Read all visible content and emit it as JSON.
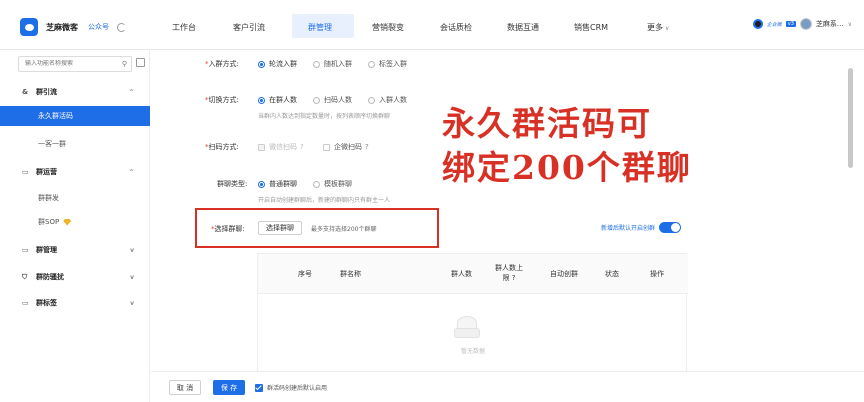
{
  "header": {
    "brand": "芝麻微客",
    "brand_sub": "公众号",
    "nav": [
      "工作台",
      "客户引流",
      "群管理",
      "营销裂变",
      "会话质检",
      "数据互通",
      "销售CRM",
      "更多"
    ],
    "user_badge": "企业微",
    "user_v": "v3",
    "user_name": "芝麻系..."
  },
  "sidebar": {
    "search_placeholder": "输入功能名称搜索",
    "groups": [
      {
        "icon": "group-icon",
        "label": "群引流",
        "items": [
          "永久群活码",
          "一客一群"
        ]
      },
      {
        "icon": "chat-icon",
        "label": "群运营",
        "items": [
          "群群发",
          "群SOP"
        ]
      },
      {
        "icon": "chat-icon",
        "label": "群管理",
        "items": []
      },
      {
        "icon": "shield-icon",
        "label": "群防骚扰",
        "items": []
      },
      {
        "icon": "chat-icon",
        "label": "群标签",
        "items": []
      }
    ]
  },
  "form": {
    "join_mode": {
      "label": "入群方式:",
      "options": [
        "轮流入群",
        "随机入群",
        "标签入群"
      ],
      "selected": 0
    },
    "switch_mode": {
      "label": "切换方式:",
      "options": [
        "在群人数",
        "扫码人数",
        "入群人数"
      ],
      "selected": 0,
      "hint": "当群内人数达到指定数量时，按列表顺序切换群聊"
    },
    "scan_mode": {
      "label": "扫码方式:",
      "options": [
        "微信扫码",
        "企微扫码"
      ]
    },
    "chat_type": {
      "label": "群聊类型:",
      "options": [
        "普通群聊",
        "模板群聊"
      ],
      "selected": 0,
      "hint": "开启自动创建群聊后，新建的群聊内只有群主一人"
    },
    "select_chat": {
      "label": "选择群聊:",
      "button": "选择群聊",
      "hint": "最多支持选择200个群聊"
    },
    "auto_create": "新增后默认开启创群"
  },
  "overlay": {
    "line1": "永久群活码可",
    "line2": "绑定200个群聊"
  },
  "table": {
    "headers": [
      "序号",
      "群名称",
      "群人数",
      "群人数上限",
      "自动创群",
      "状态",
      "操作"
    ],
    "empty": "暂无数据"
  },
  "footer": {
    "cancel": "取 消",
    "save": "保 存",
    "checkbox": "群活码创建后默认启用"
  }
}
